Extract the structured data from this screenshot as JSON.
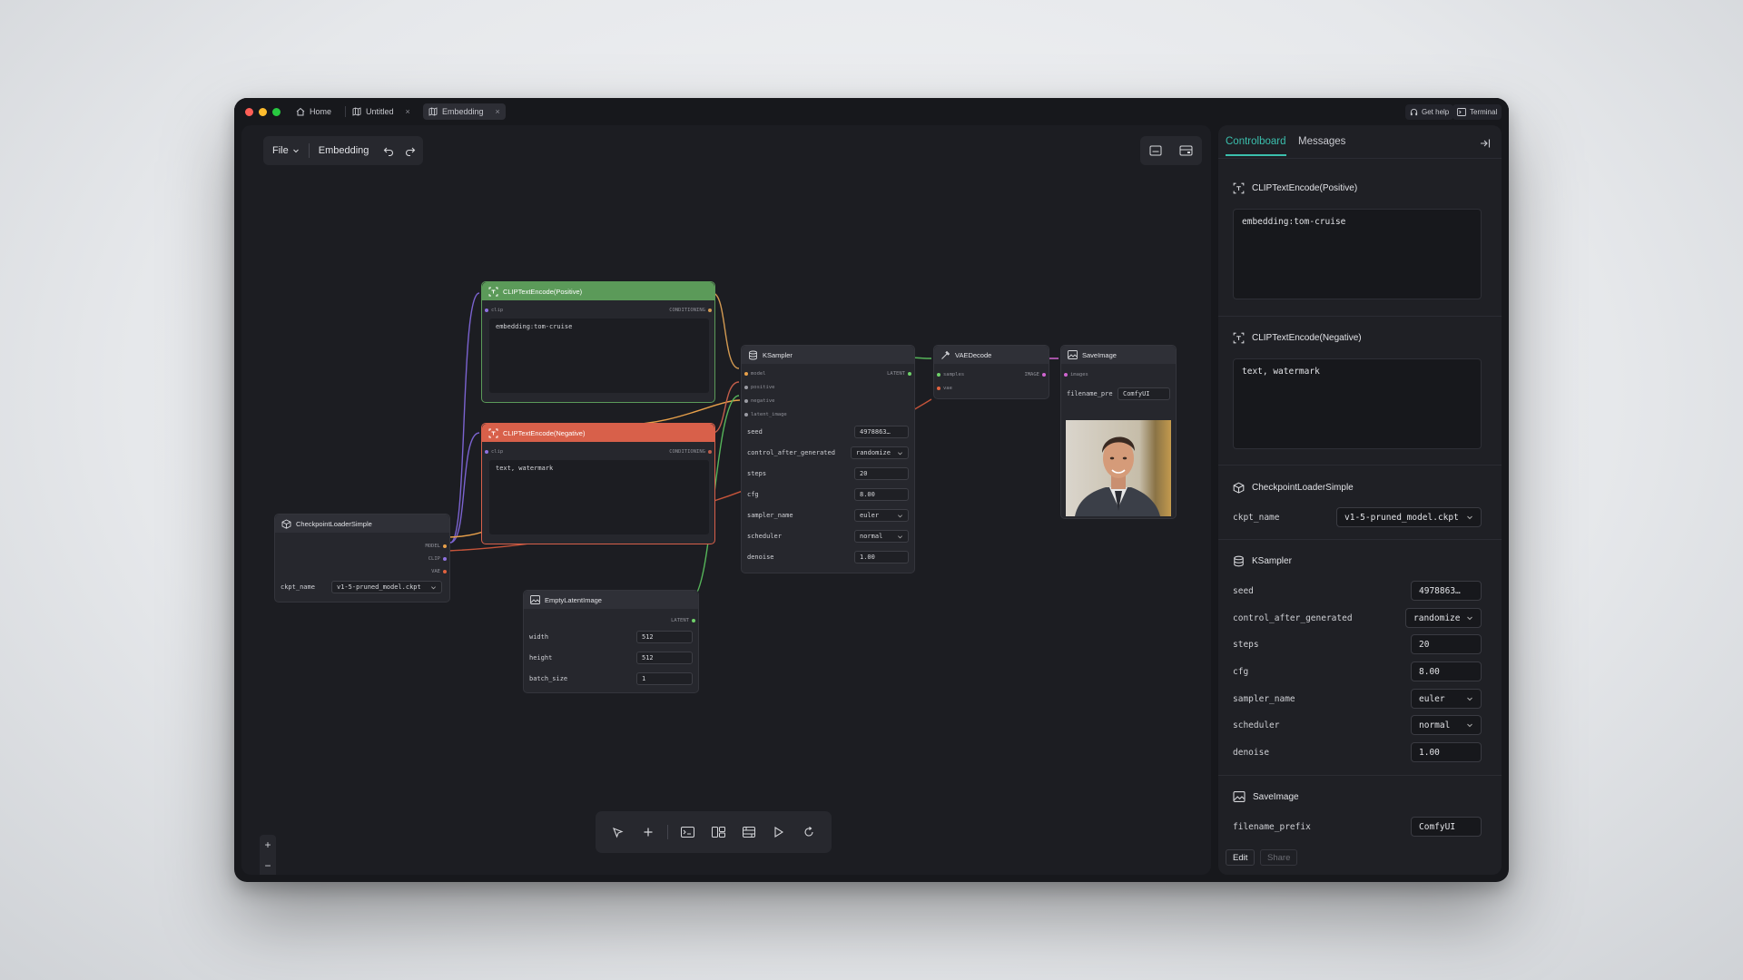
{
  "tabs": [
    {
      "label": "Home",
      "icon": "home-icon"
    },
    {
      "label": "Untitled",
      "icon": "map-icon",
      "close": "×"
    },
    {
      "label": "Embedding",
      "icon": "map-icon",
      "close": "×",
      "active": true
    }
  ],
  "titlebar_buttons": {
    "help": "Get help",
    "terminal": "Terminal"
  },
  "toolbar": {
    "file": "File",
    "workflow_name": "Embedding"
  },
  "nodes": {
    "clip_pos": {
      "title": "CLIPTextEncode(Positive)",
      "in": "clip",
      "out": "CONDITIONING",
      "text": "embedding:tom-cruise"
    },
    "clip_neg": {
      "title": "CLIPTextEncode(Negative)",
      "in": "clip",
      "out": "CONDITIONING",
      "text": "text, watermark"
    },
    "checkpoint": {
      "title": "CheckpointLoaderSimple",
      "out_model": "MODEL",
      "out_clip": "CLIP",
      "out_vae": "VAE",
      "ckpt_label": "ckpt_name",
      "ckpt_value": "v1-5-pruned_model.ckpt"
    },
    "empty_latent": {
      "title": "EmptyLatentImage",
      "out": "LATENT",
      "width_label": "width",
      "width": "512",
      "height_label": "height",
      "height": "512",
      "batch_label": "batch_size",
      "batch": "1"
    },
    "ksampler": {
      "title": "KSampler",
      "in_model": "model",
      "in_pos": "positive",
      "in_neg": "negative",
      "in_latent": "latent_image",
      "out": "LATENT",
      "seed_label": "seed",
      "seed": "4978863…",
      "cag_label": "control_after_generated",
      "cag": "randomize",
      "steps_label": "steps",
      "steps": "20",
      "cfg_label": "cfg",
      "cfg": "8.00",
      "sampler_label": "sampler_name",
      "sampler": "euler",
      "scheduler_label": "scheduler",
      "scheduler": "normal",
      "denoise_label": "denoise",
      "denoise": "1.00"
    },
    "vae": {
      "title": "VAEDecode",
      "in_samples": "samples",
      "in_vae": "vae",
      "out": "IMAGE"
    },
    "save": {
      "title": "SaveImage",
      "in": "images",
      "prefix_label": "filename_pre",
      "prefix": "ComfyUI"
    }
  },
  "panel": {
    "tab_control": "Controlboard",
    "tab_messages": "Messages",
    "pos_title": "CLIPTextEncode(Positive)",
    "pos_text": "embedding:tom-cruise",
    "neg_title": "CLIPTextEncode(Negative)",
    "neg_text": "text, watermark",
    "ckpt_title": "CheckpointLoaderSimple",
    "ckpt_label": "ckpt_name",
    "ckpt_value": "v1-5-pruned_model.ckpt",
    "ks_title": "KSampler",
    "seed_label": "seed",
    "seed": "4978863…",
    "cag_label": "control_after_generated",
    "cag": "randomize",
    "steps_label": "steps",
    "steps": "20",
    "cfg_label": "cfg",
    "cfg": "8.00",
    "sampler_label": "sampler_name",
    "sampler": "euler",
    "scheduler_label": "scheduler",
    "scheduler": "normal",
    "denoise_label": "denoise",
    "denoise": "1.00",
    "save_title": "SaveImage",
    "prefix_label": "filename_prefix",
    "prefix": "ComfyUI",
    "edit": "Edit",
    "share": "Share"
  },
  "colors": {
    "positive": "#5b9a59",
    "negative": "#d8604a",
    "accent": "#3bbfad",
    "model": "#e8a04a",
    "clip": "#8e72e0",
    "vae": "#e0623f",
    "latent": "#6fd06a",
    "image": "#d064d0"
  }
}
